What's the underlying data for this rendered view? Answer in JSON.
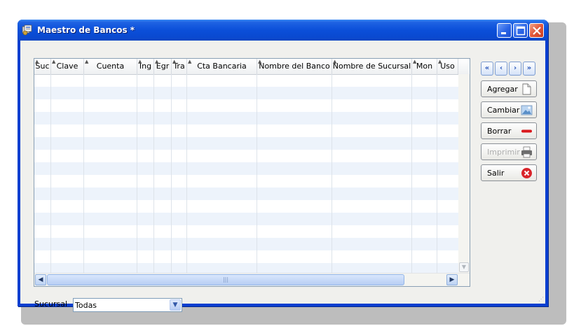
{
  "window": {
    "title": "Maestro de Bancos *"
  },
  "grid": {
    "columns": [
      {
        "label": "Suc"
      },
      {
        "label": "Clave"
      },
      {
        "label": "Cuenta"
      },
      {
        "label": "Ing"
      },
      {
        "label": "Egr"
      },
      {
        "label": "Tra"
      },
      {
        "label": "Cta Bancaria"
      },
      {
        "label": "Nombre del Banco"
      },
      {
        "label": "Nombre de Sucursal"
      },
      {
        "label": "Mon"
      },
      {
        "label": "Uso"
      }
    ],
    "rows": []
  },
  "navigation": {
    "first": "first-record",
    "previous": "previous-record",
    "next": "next-record",
    "last": "last-record"
  },
  "actions": {
    "agregar": "Agregar",
    "cambiar": "Cambiar",
    "borrar": "Borrar",
    "imprimir": "Imprimir",
    "salir": "Salir"
  },
  "filter": {
    "label": "Sucursal",
    "selected": "Todas"
  },
  "colors": {
    "titlebar": "#0a49d0",
    "client_bg": "#f0f0ed",
    "alt_row": "#edf3fb",
    "close_button": "#e2583c",
    "salir_icon": "#d9242a",
    "borrar_icon": "#d9181c"
  }
}
